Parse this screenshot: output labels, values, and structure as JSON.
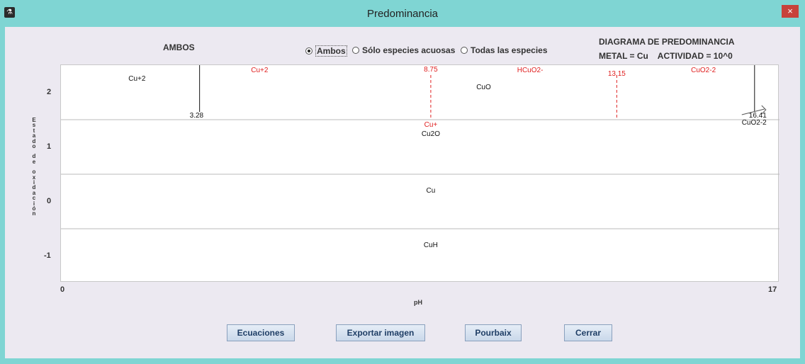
{
  "window": {
    "title": "Predominancia",
    "close": "×"
  },
  "header": {
    "left_title": "AMBOS",
    "right_title": "DIAGRAMA DE PREDOMINANCIA",
    "right_subtitle": "METAL = Cu    ACTIVIDAD = 10^0"
  },
  "radios": [
    {
      "label": "Ambos",
      "selected": true
    },
    {
      "label": "Sólo especies acuosas",
      "selected": false
    },
    {
      "label": "Todas las especies",
      "selected": false
    }
  ],
  "buttons": {
    "equations": "Ecuaciones",
    "export": "Exportar imagen",
    "pourbaix": "Pourbaix",
    "close": "Cerrar"
  },
  "chart_data": {
    "type": "predominance-diagram",
    "xlabel": "pH",
    "ylabel": "Estado de oxidación",
    "xlim": [
      0,
      17
    ],
    "x_tick_labels": [
      "0",
      "17"
    ],
    "y_tick_labels": [
      "2",
      "1",
      "0",
      "-1"
    ],
    "oxidation_states": [
      2,
      1,
      0,
      -1
    ],
    "colors": {
      "aqueous": "#e02020",
      "solid": "#111111"
    },
    "boundaries": [
      {
        "state": 2,
        "ph": 3.28,
        "label": "3.28",
        "kind": "solid"
      },
      {
        "state": 2,
        "ph": 8.75,
        "label": "8.75",
        "kind": "aqueous"
      },
      {
        "state": 2,
        "ph": 13.15,
        "label": "13.15",
        "kind": "aqueous"
      },
      {
        "state": 2,
        "ph": 16.41,
        "label": "16.41",
        "kind": "solid"
      }
    ],
    "species": [
      {
        "name": "Cu+2",
        "state": 2,
        "ph": 1.8,
        "kind": "solid",
        "row": "upper"
      },
      {
        "name": "Cu+2",
        "state": 2,
        "ph": 4.7,
        "kind": "aqueous",
        "row": "top"
      },
      {
        "name": "HCuO2-",
        "state": 2,
        "ph": 11.1,
        "kind": "aqueous",
        "row": "top"
      },
      {
        "name": "CuO2-2",
        "state": 2,
        "ph": 15.2,
        "kind": "aqueous",
        "row": "top"
      },
      {
        "name": "CuO",
        "state": 2,
        "ph": 10.0,
        "kind": "solid",
        "row": "mid"
      },
      {
        "name": "CuO2-2",
        "state": 2,
        "ph": 16.4,
        "kind": "solid",
        "row": "bottom"
      },
      {
        "name": "Cu+",
        "state": 1,
        "ph": 8.75,
        "kind": "aqueous",
        "row": "top"
      },
      {
        "name": "Cu2O",
        "state": 1,
        "ph": 8.75,
        "kind": "solid",
        "row": "upper"
      },
      {
        "name": "Cu",
        "state": 0,
        "ph": 8.75,
        "kind": "solid",
        "row": "mid"
      },
      {
        "name": "CuH",
        "state": -1,
        "ph": 8.75,
        "kind": "solid",
        "row": "mid"
      }
    ]
  }
}
